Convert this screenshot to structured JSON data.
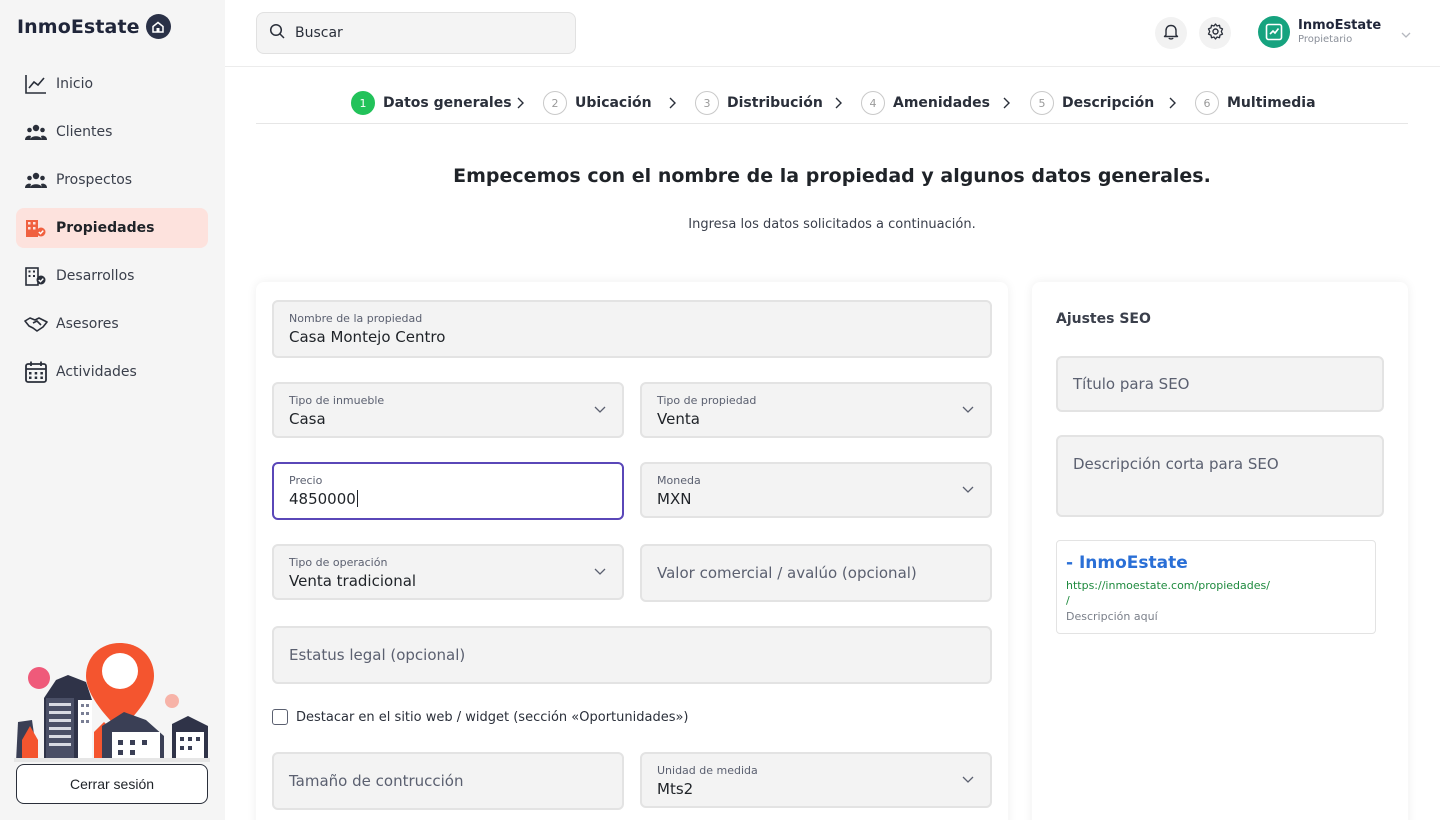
{
  "brand": {
    "name": "InmoEstate"
  },
  "sidebar": {
    "items": [
      {
        "label": "Inicio",
        "icon": "chart-line-icon"
      },
      {
        "label": "Clientes",
        "icon": "users-icon"
      },
      {
        "label": "Prospectos",
        "icon": "users-icon"
      },
      {
        "label": "Propiedades",
        "icon": "building-check-icon",
        "active": true
      },
      {
        "label": "Desarrollos",
        "icon": "building-check-icon"
      },
      {
        "label": "Asesores",
        "icon": "handshake-icon"
      },
      {
        "label": "Actividades",
        "icon": "calendar-icon"
      }
    ],
    "logout_label": "Cerrar sesión"
  },
  "header": {
    "search_placeholder": "Buscar",
    "user": {
      "name": "InmoEstate",
      "role": "Propietario"
    }
  },
  "stepper": {
    "steps": [
      {
        "num": "1",
        "label": "Datos generales",
        "active": true
      },
      {
        "num": "2",
        "label": "Ubicación"
      },
      {
        "num": "3",
        "label": "Distribución"
      },
      {
        "num": "4",
        "label": "Amenidades"
      },
      {
        "num": "5",
        "label": "Descripción"
      },
      {
        "num": "6",
        "label": "Multimedia"
      }
    ]
  },
  "intro": {
    "title": "Empecemos con el nombre de la propiedad y algunos datos generales.",
    "subtitle": "Ingresa los datos solicitados a continuación."
  },
  "form": {
    "nombre": {
      "label": "Nombre de la propiedad",
      "value": "Casa Montejo Centro"
    },
    "tipo_inmueble": {
      "label": "Tipo de inmueble",
      "value": "Casa"
    },
    "tipo_propiedad": {
      "label": "Tipo de propiedad",
      "value": "Venta"
    },
    "precio": {
      "label": "Precio",
      "value": "4850000"
    },
    "moneda": {
      "label": "Moneda",
      "value": "MXN"
    },
    "tipo_operacion": {
      "label": "Tipo de operación",
      "value": "Venta tradicional"
    },
    "valor_comercial": {
      "placeholder": "Valor comercial / avalúo (opcional)"
    },
    "estatus_legal": {
      "placeholder": "Estatus legal (opcional)"
    },
    "destacar": {
      "label": "Destacar en el sitio web / widget (sección «Oportunidades»)",
      "checked": false
    },
    "tamano": {
      "placeholder": "Tamaño de contrucción"
    },
    "unidad": {
      "label": "Unidad de medida",
      "value": "Mts2"
    }
  },
  "seo": {
    "title": "Ajustes SEO",
    "seo_title_placeholder": "Título para SEO",
    "seo_desc_placeholder": "Descripción corta para SEO",
    "preview": {
      "title": "- InmoEstate",
      "url": "https://inmoestate.com/propiedades/",
      "url_tail": "/",
      "description": "Descripción aquí"
    }
  },
  "colors": {
    "accent_active_bg": "#fde2dd",
    "step_active": "#22c25a",
    "focus_border": "#5a47b8",
    "brand_dark": "#2a3147",
    "avatar": "#16a37f",
    "link_blue": "#2a6fd6",
    "url_green": "#1e8a3e"
  }
}
